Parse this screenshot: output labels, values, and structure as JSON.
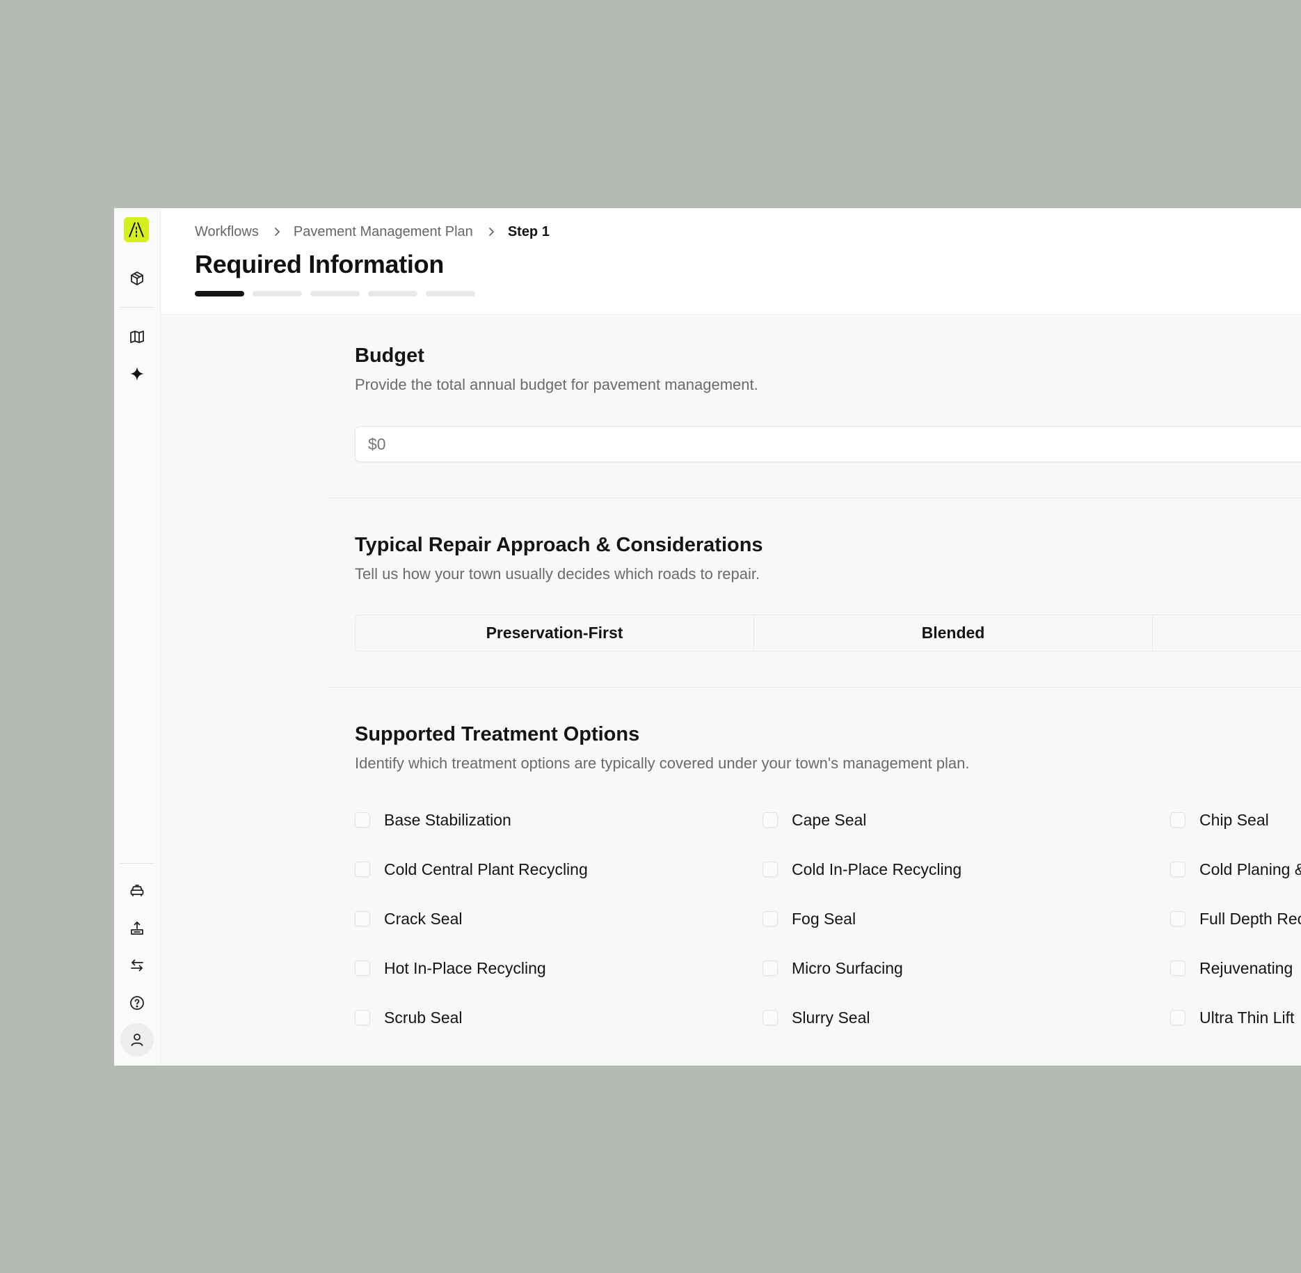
{
  "breadcrumb": [
    "Workflows",
    "Pavement Management Plan",
    "Step 1"
  ],
  "page_title": "Required Information",
  "progress": {
    "current_step": 1,
    "total_steps": 5
  },
  "budget": {
    "title": "Budget",
    "description": "Provide the total annual budget for pavement management.",
    "placeholder": "$0"
  },
  "repair": {
    "title": "Typical Repair Approach & Considerations",
    "description": "Tell us how your town usually decides which roads to repair.",
    "options": [
      "Preservation-First",
      "Blended",
      ""
    ]
  },
  "treatments": {
    "title": "Supported Treatment Options",
    "description": "Identify which treatment options are typically covered under your town's management plan.",
    "options": [
      "Base Stabilization",
      "Cape Seal",
      "Chip Seal",
      "Cold Central Plant Recycling",
      "Cold In-Place Recycling",
      "Cold Planing &",
      "Crack Seal",
      "Fog Seal",
      "Full Depth Rec",
      "Hot In-Place Recycling",
      "Micro Surfacing",
      "Rejuvenating",
      "Scrub Seal",
      "Slurry Seal",
      "Ultra Thin Lift"
    ]
  },
  "sidebar_icons": [
    "logo-icon",
    "cube-icon",
    "map-icon",
    "sparkle-icon",
    "car-icon",
    "upload-icon",
    "swap-icon",
    "help-icon",
    "user-icon"
  ],
  "colors": {
    "accent": "#d6f01f",
    "background": "#b4bbb3",
    "text": "#141414",
    "muted": "#6b6b6b"
  }
}
